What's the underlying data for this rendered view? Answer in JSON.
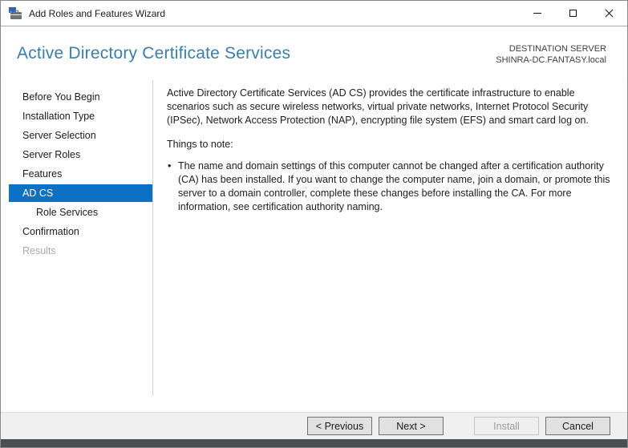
{
  "window": {
    "title": "Add Roles and Features Wizard"
  },
  "header": {
    "page_title": "Active Directory Certificate Services",
    "destination_label": "DESTINATION SERVER",
    "destination_server": "SHINRA-DC.FANTASY.local"
  },
  "sidebar": {
    "items": [
      {
        "label": "Before You Begin",
        "state": "normal"
      },
      {
        "label": "Installation Type",
        "state": "normal"
      },
      {
        "label": "Server Selection",
        "state": "normal"
      },
      {
        "label": "Server Roles",
        "state": "normal"
      },
      {
        "label": "Features",
        "state": "normal"
      },
      {
        "label": "AD CS",
        "state": "selected"
      },
      {
        "label": "Role Services",
        "state": "normal-indented"
      },
      {
        "label": "Confirmation",
        "state": "normal"
      },
      {
        "label": "Results",
        "state": "disabled"
      }
    ]
  },
  "content": {
    "intro": "Active Directory Certificate Services (AD CS) provides the certificate infrastructure to enable scenarios such as secure wireless networks, virtual private networks, Internet Protocol Security (IPSec), Network Access Protection (NAP), encrypting file system (EFS) and smart card log on.",
    "note_heading": "Things to note:",
    "notes": [
      "The name and domain settings of this computer cannot be changed after a certification authority (CA) has been installed. If you want to change the computer name, join a domain, or promote this server to a domain controller, complete these changes before installing the CA. For more information, see certification authority naming."
    ]
  },
  "footer": {
    "previous_label": "< Previous",
    "next_label": "Next >",
    "install_label": "Install",
    "cancel_label": "Cancel"
  },
  "colors": {
    "page_title_blue": "#3b7dab",
    "selected_nav_blue": "#0c71c3",
    "disabled_text_gray": "#a9a9a9",
    "footer_gray": "#f0f0f0",
    "bottom_strip_gray": "#4b4f53"
  }
}
